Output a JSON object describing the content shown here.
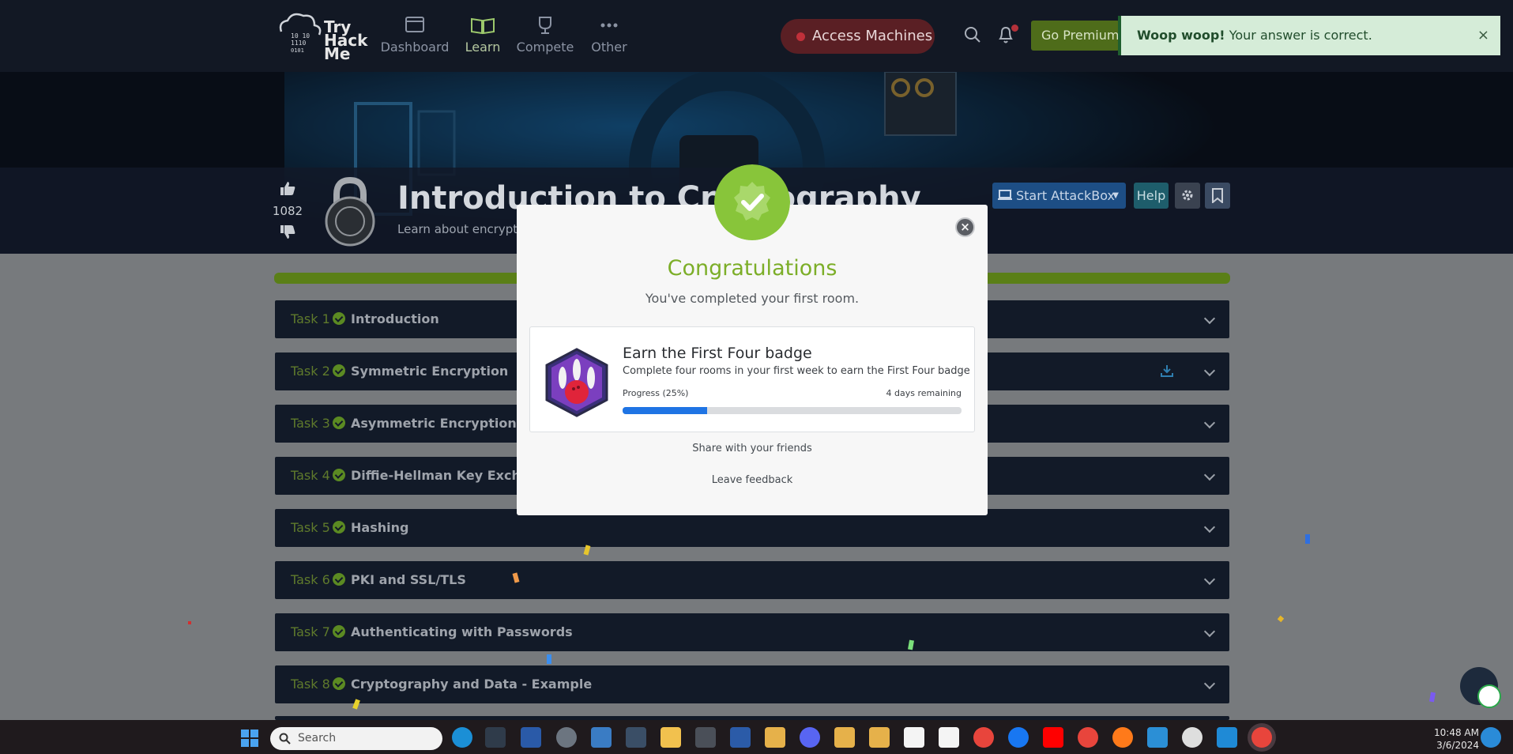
{
  "nav": {
    "logo_lines": [
      "Try",
      "Hack",
      "Me"
    ],
    "items": [
      {
        "label": "Dashboard",
        "icon": "dashboard-icon"
      },
      {
        "label": "Learn",
        "icon": "book-icon"
      },
      {
        "label": "Compete",
        "icon": "trophy-icon"
      },
      {
        "label": "Other",
        "icon": "more-dots-icon"
      }
    ],
    "access_machines": "Access Machines",
    "go_premium": "Go Premium"
  },
  "toast": {
    "bold": "Woop woop!",
    "text": " Your answer is correct.",
    "close": "×"
  },
  "room": {
    "votes": "1082",
    "title": "Introduction to Cryptography",
    "subtitle": "Learn about encryption",
    "start_attackbox": "Start AttackBox",
    "help": "Help"
  },
  "tasks": [
    {
      "num": "Task 1",
      "name": "Introduction"
    },
    {
      "num": "Task 2",
      "name": "Symmetric Encryption"
    },
    {
      "num": "Task 3",
      "name": "Asymmetric Encryption"
    },
    {
      "num": "Task 4",
      "name": "Diffie-Hellman Key Exchange"
    },
    {
      "num": "Task 5",
      "name": "Hashing"
    },
    {
      "num": "Task 6",
      "name": "PKI and SSL/TLS"
    },
    {
      "num": "Task 7",
      "name": "Authenticating with Passwords"
    },
    {
      "num": "Task 8",
      "name": "Cryptography and Data - Example"
    }
  ],
  "modal": {
    "title": "Congratulations",
    "subtitle": "You've completed your first room.",
    "badge_name": "Earn the First Four badge",
    "badge_desc": "Complete four rooms in your first week to earn the First Four badge",
    "progress_label": "Progress (25%)",
    "progress_value": 0.25,
    "days_remaining": "4 days remaining",
    "share": "Share with your friends",
    "feedback": "Leave feedback",
    "close": "×"
  },
  "taskbar": {
    "search_placeholder": "Search",
    "time": "10:48 AM",
    "date": "3/6/2024"
  },
  "colors": {
    "accent_green": "#88c53a",
    "progress_blue": "#1f74e4",
    "nav_bg": "#1c2538"
  }
}
